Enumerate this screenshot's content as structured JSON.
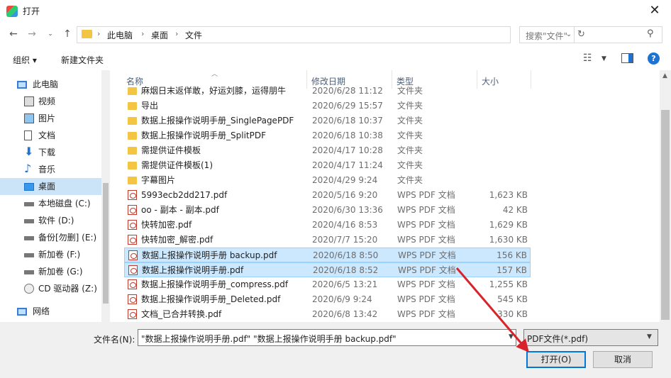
{
  "window": {
    "title": "打开",
    "close": "✕"
  },
  "address": {
    "segments": [
      "此电脑",
      "桌面",
      "文件"
    ],
    "separator": "›"
  },
  "search": {
    "placeholder": "搜索\"文件\""
  },
  "toolbar": {
    "organize": "组织 ▾",
    "new_folder": "新建文件夹",
    "help": "?"
  },
  "nav": {
    "items": [
      {
        "label": "此电脑",
        "icon": "computer-icon"
      },
      {
        "label": "视频",
        "icon": "video-icon"
      },
      {
        "label": "图片",
        "icon": "picture-icon"
      },
      {
        "label": "文档",
        "icon": "document-icon"
      },
      {
        "label": "下载",
        "icon": "download-icon"
      },
      {
        "label": "音乐",
        "icon": "music-icon"
      },
      {
        "label": "桌面",
        "icon": "desktop-icon"
      },
      {
        "label": "本地磁盘 (C:)",
        "icon": "drive-icon"
      },
      {
        "label": "软件 (D:)",
        "icon": "drive-icon"
      },
      {
        "label": "备份[勿删] (E:)",
        "icon": "drive-icon"
      },
      {
        "label": "新加卷 (F:)",
        "icon": "drive-icon"
      },
      {
        "label": "新加卷 (G:)",
        "icon": "drive-icon"
      },
      {
        "label": "CD 驱动器 (Z:)",
        "icon": "cd-icon"
      },
      {
        "label": "网络",
        "icon": "network-icon"
      }
    ]
  },
  "columns": {
    "name": "名称",
    "date": "修改日期",
    "type": "类型",
    "size": "大小"
  },
  "files": [
    {
      "name": "麻烟日末返佯敢，好运刘膝，运得朋牛",
      "date": "2020/6/28 11:12",
      "type": "文件夹",
      "size": "",
      "kind": "folder"
    },
    {
      "name": "导出",
      "date": "2020/6/29 15:57",
      "type": "文件夹",
      "size": "",
      "kind": "folder"
    },
    {
      "name": "数据上报操作说明手册_SinglePagePDF",
      "date": "2020/6/18 10:37",
      "type": "文件夹",
      "size": "",
      "kind": "folder"
    },
    {
      "name": "数据上报操作说明手册_SplitPDF",
      "date": "2020/6/18 10:38",
      "type": "文件夹",
      "size": "",
      "kind": "folder"
    },
    {
      "name": "需提供证件模板",
      "date": "2020/4/17 10:28",
      "type": "文件夹",
      "size": "",
      "kind": "folder"
    },
    {
      "name": "需提供证件模板(1)",
      "date": "2020/4/17 11:24",
      "type": "文件夹",
      "size": "",
      "kind": "folder"
    },
    {
      "name": "字幕图片",
      "date": "2020/4/29 9:24",
      "type": "文件夹",
      "size": "",
      "kind": "folder"
    },
    {
      "name": "5993ecb2dd217.pdf",
      "date": "2020/5/16 9:20",
      "type": "WPS PDF 文档",
      "size": "1,623 KB",
      "kind": "pdf"
    },
    {
      "name": "oo - 副本 - 副本.pdf",
      "date": "2020/6/30 13:36",
      "type": "WPS PDF 文档",
      "size": "42 KB",
      "kind": "pdf"
    },
    {
      "name": "快转加密.pdf",
      "date": "2020/4/16 8:53",
      "type": "WPS PDF 文档",
      "size": "1,629 KB",
      "kind": "pdf"
    },
    {
      "name": "快转加密_解密.pdf",
      "date": "2020/7/7 15:20",
      "type": "WPS PDF 文档",
      "size": "1,630 KB",
      "kind": "pdf"
    },
    {
      "name": "数据上报操作说明手册 backup.pdf",
      "date": "2020/6/18 8:50",
      "type": "WPS PDF 文档",
      "size": "156 KB",
      "kind": "pdf",
      "selected": true
    },
    {
      "name": "数据上报操作说明手册.pdf",
      "date": "2020/6/18 8:52",
      "type": "WPS PDF 文档",
      "size": "157 KB",
      "kind": "pdf",
      "selected": true
    },
    {
      "name": "数据上报操作说明手册_compress.pdf",
      "date": "2020/6/5 13:21",
      "type": "WPS PDF 文档",
      "size": "1,255 KB",
      "kind": "pdf"
    },
    {
      "name": "数据上报操作说明手册_Deleted.pdf",
      "date": "2020/6/9 9:24",
      "type": "WPS PDF 文档",
      "size": "545 KB",
      "kind": "pdf"
    },
    {
      "name": "文档_已合并转换.pdf",
      "date": "2020/6/8 13:42",
      "type": "WPS PDF 文档",
      "size": "330 KB",
      "kind": "pdf"
    }
  ],
  "footer": {
    "filename_label": "文件名(N):",
    "filename_value": "\"数据上报操作说明手册.pdf\" \"数据上报操作说明手册 backup.pdf\"",
    "filetype": "PDF文件(*.pdf)",
    "open": "打开(O)",
    "cancel": "取消"
  },
  "colors": {
    "selection": "#cce8ff",
    "accent": "#0078d7",
    "arrow": "#d9232a"
  }
}
